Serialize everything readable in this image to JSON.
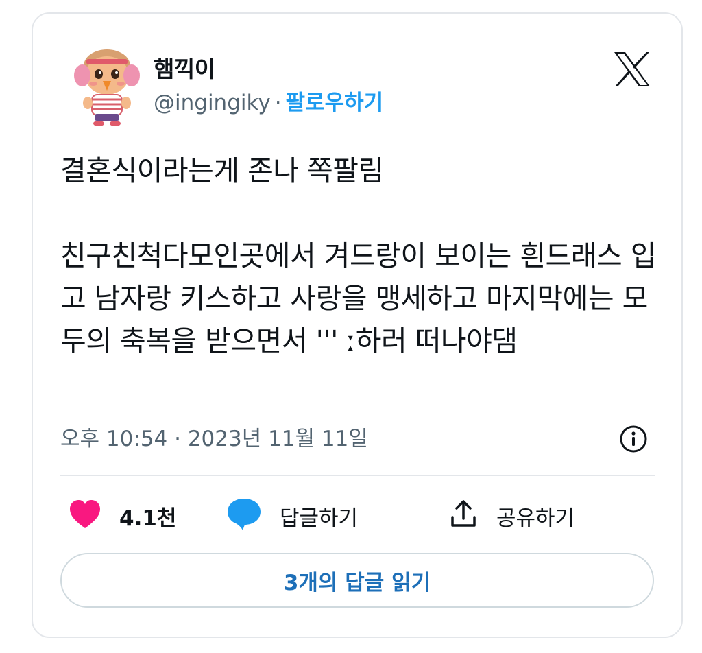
{
  "author": {
    "display_name": "햄끽이",
    "handle": "@ingingiky",
    "separator": "·",
    "follow_label": "팔로우하기",
    "avatar_icon": "villager-avatar-icon"
  },
  "platform_icon": "x-logo-icon",
  "tweet": {
    "text": "결혼식이라는게 존나 쪽팔림\n\n친구친척다모인곳에서 겨드랑이 보이는 흰드래스 입고 남자랑 키스하고 사랑을 맹세하고 마지막에는 모두의 축복을 받으면서 ''' ː하러 떠나야댐"
  },
  "meta": {
    "time": "오후 10:54",
    "separator": "·",
    "date": "2023년 11월 11일",
    "info_icon": "info-icon"
  },
  "actions": {
    "like_count": "4.1천",
    "reply_label": "답글하기",
    "share_label": "공유하기"
  },
  "read_replies_label": "3개의 답글 읽기",
  "colors": {
    "accent_blue": "#1d9bf0",
    "heart_pink": "#f91880",
    "border": "#e3e6ea"
  }
}
